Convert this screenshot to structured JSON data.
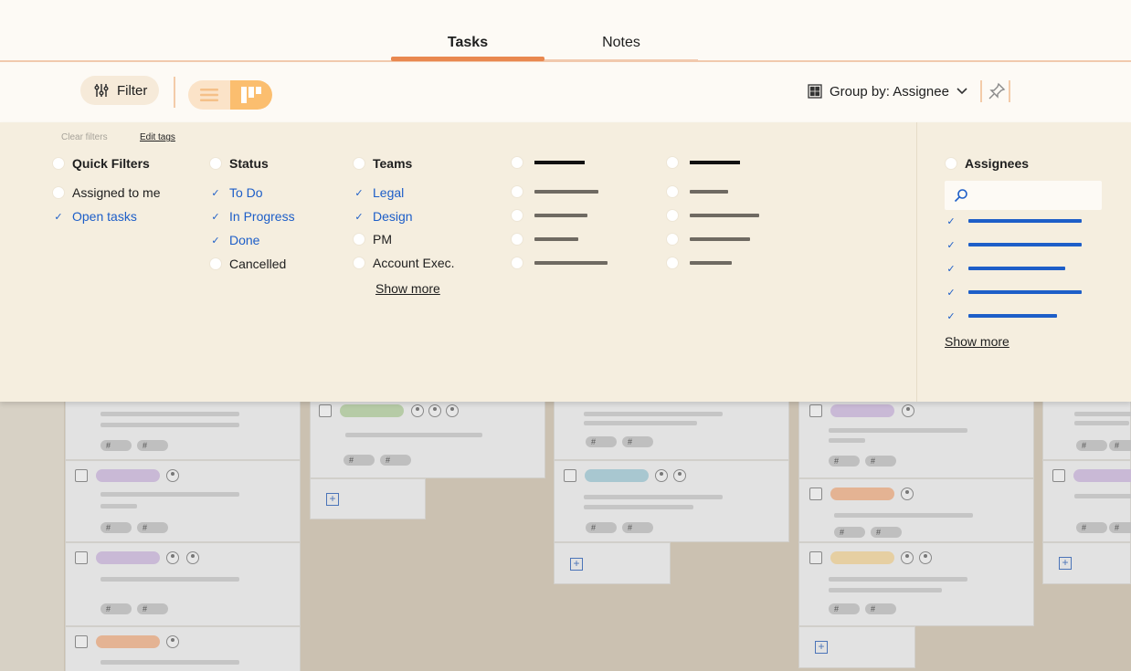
{
  "tabs": {
    "tasks": "Tasks",
    "notes": "Notes"
  },
  "toolbar": {
    "filter_label": "Filter",
    "group_by_label": "Group by: Assignee"
  },
  "panel": {
    "clear_filters": "Clear filters",
    "edit_tags": "Edit tags",
    "quick_filters": {
      "title": "Quick Filters",
      "items": [
        "Assigned to me",
        "Open tasks"
      ]
    },
    "status": {
      "title": "Status",
      "items": [
        "To Do",
        "In Progress",
        "Done",
        "Cancelled"
      ]
    },
    "teams": {
      "title": "Teams",
      "items": [
        "Legal",
        "Design",
        "PM",
        "Account Exec."
      ],
      "show_more": "Show more"
    },
    "assignees": {
      "title": "Assignees",
      "show_more": "Show more"
    }
  },
  "board": {
    "tag_symbol": "#"
  },
  "colors": {
    "accent": "#e9884f",
    "selected": "#1d5ec8",
    "panel": "#f5eedf"
  }
}
